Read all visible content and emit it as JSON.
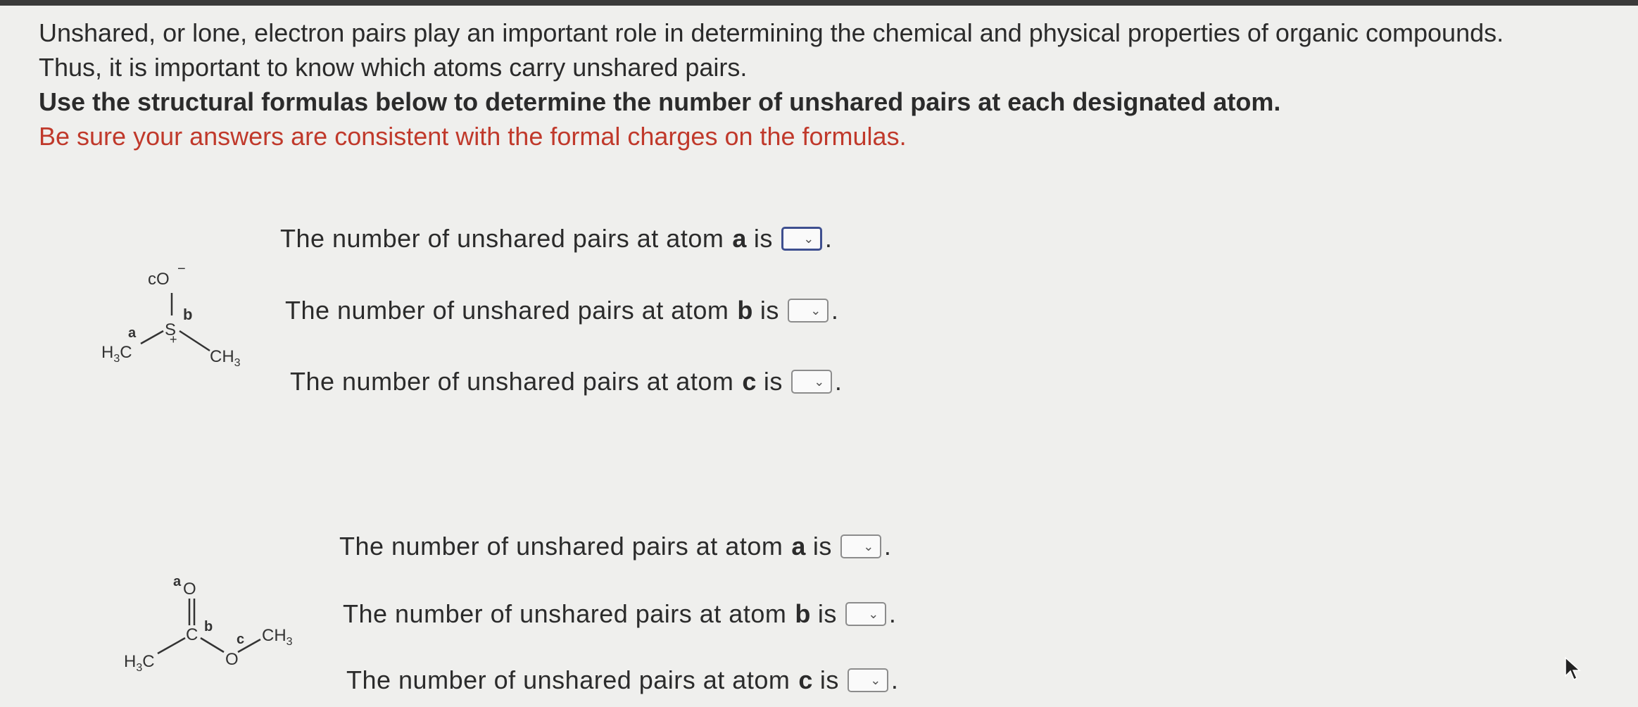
{
  "intro": {
    "line1": "Unshared, or lone, electron pairs play an important role in determining the chemical and physical properties of organic compounds.",
    "line2": "Thus, it is important to know which atoms carry unshared pairs.",
    "instruction": "Use the structural formulas below to determine the number of unshared pairs at each designated atom.",
    "warning": "Be sure your answers are consistent with the formal charges on the formulas."
  },
  "problem1": {
    "molecule": {
      "co_label": "cO",
      "charge_minus": "−",
      "atom_b": "b",
      "atom_a": "a",
      "s_label": "S",
      "charge_plus": "+",
      "h3c": "H",
      "h3c_sub": "3",
      "h3c_c": "C",
      "ch3": "CH",
      "ch3_sub": "3"
    },
    "questions": [
      {
        "prefix": "The number of unshared pairs at atom",
        "atom": "a",
        "suffix": "is",
        "value": ""
      },
      {
        "prefix": "The number of unshared pairs at atom",
        "atom": "b",
        "suffix": "is",
        "value": ""
      },
      {
        "prefix": "The number of unshared pairs at atom",
        "atom": "c",
        "suffix": "is",
        "value": ""
      }
    ]
  },
  "problem2": {
    "molecule": {
      "atom_a": "a",
      "o_top": "O",
      "c_label": "C",
      "atom_b": "b",
      "atom_c": "c",
      "o_bottom": "O",
      "ch3": "CH",
      "ch3_sub": "3",
      "h3c": "H",
      "h3c_sub": "3",
      "h3c_c": "C"
    },
    "questions": [
      {
        "prefix": "The number of unshared pairs at atom",
        "atom": "a",
        "suffix": "is",
        "value": ""
      },
      {
        "prefix": "The number of unshared pairs at atom",
        "atom": "b",
        "suffix": "is",
        "value": ""
      },
      {
        "prefix": "The number of unshared pairs at atom",
        "atom": "c",
        "suffix": "is",
        "value": ""
      }
    ]
  },
  "icons": {
    "dropdown": "chevron-down-icon",
    "cursor": "mouse-pointer-icon"
  }
}
